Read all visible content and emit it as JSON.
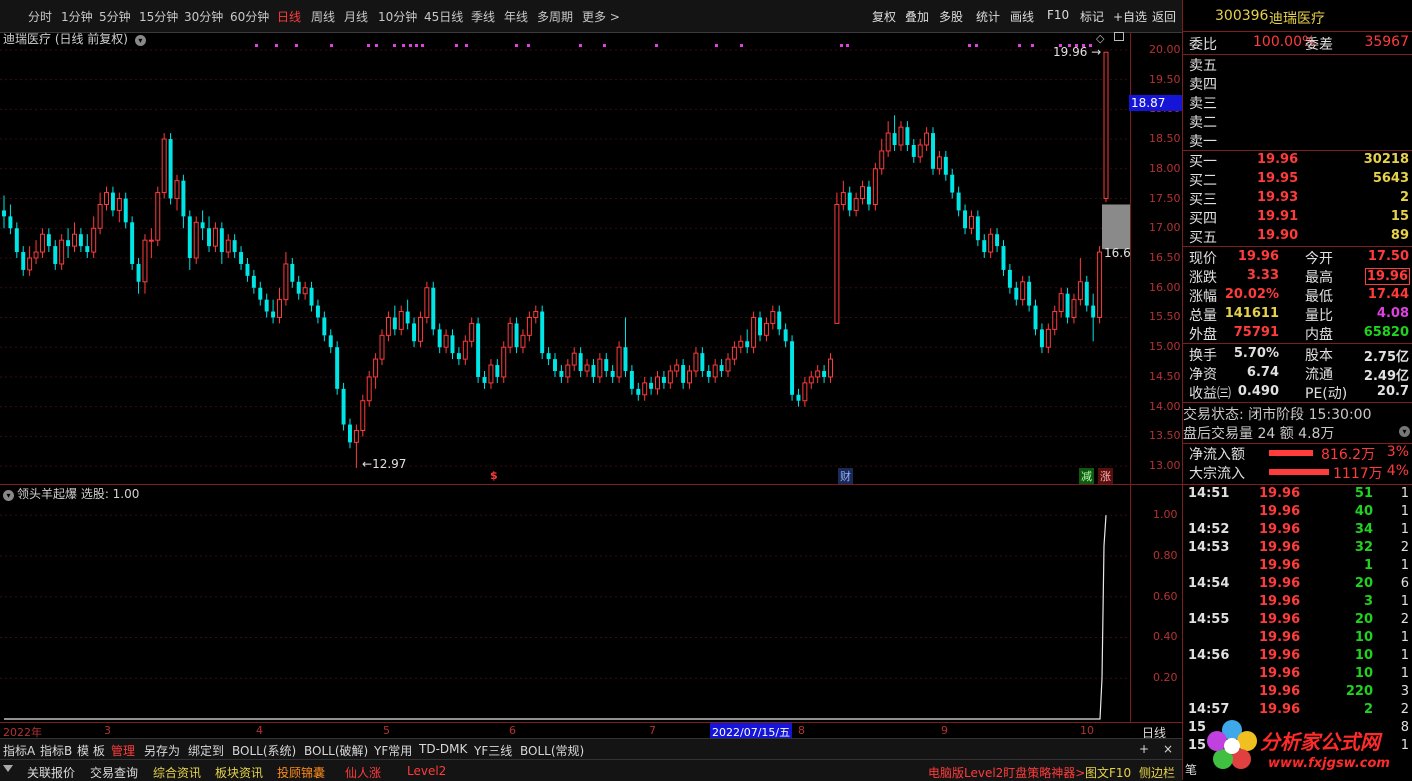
{
  "toolbar": {
    "timeframes": [
      "分时",
      "1分钟",
      "5分钟",
      "15分钟",
      "30分钟",
      "60分钟",
      "日线",
      "周线",
      "月线",
      "10分钟",
      "45日线",
      "季线",
      "年线",
      "多周期",
      "更多 >"
    ],
    "active": "日线",
    "right_buttons": [
      "复权",
      "叠加",
      "多股",
      "统计",
      "画线",
      "F10",
      "标记",
      "+自选",
      "返回"
    ]
  },
  "chart": {
    "title": "迪瑞医疗 (日线 前复权)",
    "price_axis": [
      "20.00",
      "19.50",
      "19.00",
      "18.50",
      "18.00",
      "17.50",
      "17.00",
      "16.50",
      "16.00",
      "15.50",
      "15.00",
      "14.50",
      "14.00",
      "13.50",
      "13.00"
    ],
    "current_price_tag": "18.87",
    "high_annotation": "19.96",
    "low_annotation": "12.97",
    "right_annotation": "16.6",
    "markers": {
      "dollar": "$",
      "fin": "财",
      "jian": "减",
      "zhang": "涨"
    }
  },
  "chart_data": {
    "type": "candlestick",
    "title": "迪瑞医疗 (日线 前复权)",
    "ylim": [
      12.7,
      20.3
    ],
    "y_ticks": [
      13.0,
      13.5,
      14.0,
      14.5,
      15.0,
      15.5,
      16.0,
      16.5,
      17.0,
      17.5,
      18.0,
      18.5,
      19.0,
      19.5,
      20.0
    ],
    "candles": [
      [
        17.3,
        17.2,
        17.55,
        17.0
      ],
      [
        17.2,
        17.0,
        17.4,
        16.9
      ],
      [
        17.0,
        16.6,
        17.1,
        16.5
      ],
      [
        16.6,
        16.3,
        16.7,
        16.2
      ],
      [
        16.3,
        16.5,
        16.7,
        16.2
      ],
      [
        16.5,
        16.6,
        16.8,
        16.4
      ],
      [
        16.6,
        16.9,
        17.0,
        16.5
      ],
      [
        16.9,
        16.7,
        17.0,
        16.6
      ],
      [
        16.7,
        16.4,
        16.8,
        16.3
      ],
      [
        16.4,
        16.8,
        16.9,
        16.3
      ],
      [
        16.8,
        16.7,
        17.0,
        16.5
      ],
      [
        16.7,
        16.9,
        17.1,
        16.6
      ],
      [
        16.9,
        16.7,
        17.0,
        16.6
      ],
      [
        16.7,
        16.6,
        16.9,
        16.5
      ],
      [
        16.6,
        17.0,
        17.2,
        16.5
      ],
      [
        17.0,
        17.4,
        17.6,
        16.9
      ],
      [
        17.4,
        17.6,
        17.7,
        17.3
      ],
      [
        17.6,
        17.3,
        17.7,
        17.2
      ],
      [
        17.3,
        17.5,
        17.6,
        17.1
      ],
      [
        17.5,
        17.1,
        17.6,
        17.0
      ],
      [
        17.1,
        16.4,
        17.2,
        16.3
      ],
      [
        16.4,
        16.1,
        16.5,
        15.9
      ],
      [
        16.1,
        16.8,
        16.9,
        15.9
      ],
      [
        16.8,
        16.8,
        17.0,
        16.5
      ],
      [
        16.8,
        17.6,
        17.7,
        16.7
      ],
      [
        17.6,
        18.5,
        18.6,
        17.5
      ],
      [
        18.5,
        17.5,
        18.6,
        17.4
      ],
      [
        17.5,
        17.8,
        17.9,
        17.3
      ],
      [
        17.8,
        17.2,
        17.9,
        17.0
      ],
      [
        17.2,
        16.5,
        17.3,
        16.3
      ],
      [
        16.5,
        17.1,
        17.2,
        16.4
      ],
      [
        17.1,
        17.0,
        17.3,
        16.8
      ],
      [
        17.0,
        16.7,
        17.2,
        16.6
      ],
      [
        16.7,
        17.0,
        17.1,
        16.6
      ],
      [
        17.0,
        16.6,
        17.1,
        16.4
      ],
      [
        16.6,
        16.8,
        16.9,
        16.5
      ],
      [
        16.8,
        16.6,
        16.9,
        16.5
      ],
      [
        16.6,
        16.4,
        16.7,
        16.3
      ],
      [
        16.4,
        16.2,
        16.5,
        16.1
      ],
      [
        16.2,
        16.0,
        16.3,
        15.9
      ],
      [
        16.0,
        15.8,
        16.1,
        15.7
      ],
      [
        15.8,
        15.6,
        15.9,
        15.5
      ],
      [
        15.6,
        15.5,
        15.8,
        15.4
      ],
      [
        15.5,
        15.8,
        16.0,
        15.4
      ],
      [
        15.8,
        16.4,
        16.6,
        15.7
      ],
      [
        16.4,
        16.1,
        16.5,
        16.0
      ],
      [
        16.1,
        15.9,
        16.2,
        15.8
      ],
      [
        15.9,
        16.0,
        16.1,
        15.8
      ],
      [
        16.0,
        15.7,
        16.1,
        15.6
      ],
      [
        15.7,
        15.5,
        15.8,
        15.4
      ],
      [
        15.5,
        15.2,
        15.6,
        15.1
      ],
      [
        15.2,
        15.0,
        15.3,
        14.9
      ],
      [
        15.0,
        14.3,
        15.1,
        14.2
      ],
      [
        14.3,
        13.7,
        14.4,
        13.6
      ],
      [
        13.7,
        13.4,
        13.8,
        13.3
      ],
      [
        13.4,
        13.6,
        13.7,
        12.97
      ],
      [
        13.6,
        14.1,
        14.2,
        13.5
      ],
      [
        14.1,
        14.5,
        14.6,
        14.0
      ],
      [
        14.5,
        14.8,
        14.9,
        14.3
      ],
      [
        14.8,
        15.2,
        15.3,
        14.7
      ],
      [
        15.2,
        15.5,
        15.6,
        15.1
      ],
      [
        15.5,
        15.3,
        15.7,
        15.2
      ],
      [
        15.3,
        15.6,
        15.7,
        15.2
      ],
      [
        15.6,
        15.4,
        15.8,
        15.3
      ],
      [
        15.4,
        15.1,
        15.5,
        15.0
      ],
      [
        15.1,
        15.5,
        15.6,
        15.0
      ],
      [
        15.5,
        16.0,
        16.1,
        15.4
      ],
      [
        16.0,
        15.3,
        16.1,
        15.2
      ],
      [
        15.3,
        15.0,
        15.4,
        14.9
      ],
      [
        15.0,
        15.2,
        15.3,
        14.9
      ],
      [
        15.2,
        14.9,
        15.3,
        14.8
      ],
      [
        14.9,
        14.8,
        15.0,
        14.7
      ],
      [
        14.8,
        15.1,
        15.2,
        14.7
      ],
      [
        15.1,
        15.4,
        15.5,
        15.0
      ],
      [
        15.4,
        14.5,
        15.5,
        14.4
      ],
      [
        14.5,
        14.4,
        14.6,
        14.3
      ],
      [
        14.4,
        14.7,
        14.8,
        14.3
      ],
      [
        14.7,
        14.5,
        14.8,
        14.4
      ],
      [
        14.5,
        15.0,
        15.1,
        14.4
      ],
      [
        15.0,
        15.4,
        15.5,
        14.9
      ],
      [
        15.4,
        15.0,
        15.5,
        14.9
      ],
      [
        15.0,
        15.2,
        15.3,
        14.9
      ],
      [
        15.2,
        15.5,
        15.6,
        15.1
      ],
      [
        15.5,
        15.6,
        15.7,
        15.4
      ],
      [
        15.6,
        14.9,
        15.7,
        14.8
      ],
      [
        14.9,
        14.8,
        15.0,
        14.7
      ],
      [
        14.8,
        14.6,
        14.9,
        14.5
      ],
      [
        14.6,
        14.5,
        14.7,
        14.4
      ],
      [
        14.5,
        14.7,
        14.8,
        14.4
      ],
      [
        14.7,
        14.9,
        15.0,
        14.6
      ],
      [
        14.9,
        14.6,
        15.0,
        14.5
      ],
      [
        14.6,
        14.7,
        14.8,
        14.5
      ],
      [
        14.7,
        14.5,
        14.8,
        14.4
      ],
      [
        14.5,
        14.8,
        14.9,
        14.4
      ],
      [
        14.8,
        14.6,
        14.9,
        14.5
      ],
      [
        14.6,
        14.5,
        14.7,
        14.4
      ],
      [
        14.5,
        15.0,
        15.1,
        14.4
      ],
      [
        15.0,
        14.6,
        15.5,
        14.5
      ],
      [
        14.6,
        14.3,
        14.7,
        14.2
      ],
      [
        14.3,
        14.2,
        14.4,
        14.1
      ],
      [
        14.2,
        14.4,
        14.5,
        14.1
      ],
      [
        14.4,
        14.3,
        14.5,
        14.2
      ],
      [
        14.3,
        14.5,
        14.6,
        14.2
      ],
      [
        14.5,
        14.4,
        14.6,
        14.3
      ],
      [
        14.4,
        14.6,
        14.7,
        14.3
      ],
      [
        14.6,
        14.7,
        14.8,
        14.5
      ],
      [
        14.7,
        14.4,
        14.8,
        14.3
      ],
      [
        14.4,
        14.6,
        14.7,
        14.3
      ],
      [
        14.6,
        14.9,
        15.0,
        14.5
      ],
      [
        14.9,
        14.6,
        15.0,
        14.5
      ],
      [
        14.6,
        14.5,
        14.7,
        14.4
      ],
      [
        14.5,
        14.7,
        14.8,
        14.4
      ],
      [
        14.7,
        14.6,
        14.8,
        14.5
      ],
      [
        14.6,
        14.8,
        14.9,
        14.5
      ],
      [
        14.8,
        15.0,
        15.1,
        14.7
      ],
      [
        15.0,
        15.1,
        15.2,
        14.9
      ],
      [
        15.1,
        15.0,
        15.3,
        14.9
      ],
      [
        15.0,
        15.5,
        15.6,
        14.9
      ],
      [
        15.5,
        15.2,
        15.6,
        15.1
      ],
      [
        15.2,
        15.4,
        15.5,
        15.1
      ],
      [
        15.4,
        15.6,
        15.7,
        15.3
      ],
      [
        15.6,
        15.3,
        15.7,
        15.2
      ],
      [
        15.3,
        15.1,
        15.4,
        15.0
      ],
      [
        15.1,
        14.2,
        15.2,
        14.1
      ],
      [
        14.2,
        14.1,
        14.3,
        14.0
      ],
      [
        14.1,
        14.4,
        14.5,
        14.0
      ],
      [
        14.4,
        14.5,
        14.6,
        14.3
      ],
      [
        14.5,
        14.6,
        14.7,
        14.4
      ],
      [
        14.6,
        14.5,
        14.7,
        14.4
      ],
      [
        14.5,
        14.8,
        14.9,
        14.4
      ],
      [
        15.4,
        17.4,
        17.6,
        15.4
      ],
      [
        17.4,
        17.6,
        17.8,
        17.3
      ],
      [
        17.6,
        17.3,
        17.7,
        17.2
      ],
      [
        17.3,
        17.5,
        17.6,
        17.2
      ],
      [
        17.5,
        17.7,
        17.8,
        17.4
      ],
      [
        17.7,
        17.4,
        17.8,
        17.3
      ],
      [
        17.4,
        18.0,
        18.1,
        17.3
      ],
      [
        18.0,
        18.3,
        18.5,
        17.9
      ],
      [
        18.3,
        18.6,
        18.8,
        18.2
      ],
      [
        18.6,
        18.4,
        18.9,
        18.3
      ],
      [
        18.4,
        18.7,
        18.8,
        18.3
      ],
      [
        18.7,
        18.4,
        18.8,
        18.3
      ],
      [
        18.4,
        18.2,
        18.5,
        18.1
      ],
      [
        18.2,
        18.4,
        18.5,
        18.1
      ],
      [
        18.4,
        18.6,
        18.7,
        18.3
      ],
      [
        18.6,
        18.0,
        18.7,
        17.9
      ],
      [
        18.0,
        18.2,
        18.3,
        17.9
      ],
      [
        18.2,
        17.9,
        18.3,
        17.8
      ],
      [
        17.9,
        17.6,
        18.0,
        17.5
      ],
      [
        17.6,
        17.3,
        17.7,
        17.2
      ],
      [
        17.3,
        17.0,
        17.4,
        16.9
      ],
      [
        17.0,
        17.2,
        17.3,
        16.9
      ],
      [
        17.2,
        16.8,
        17.3,
        16.7
      ],
      [
        16.8,
        16.6,
        16.9,
        16.5
      ],
      [
        16.6,
        16.9,
        17.0,
        16.5
      ],
      [
        16.9,
        16.7,
        17.0,
        16.6
      ],
      [
        16.7,
        16.3,
        16.8,
        16.2
      ],
      [
        16.3,
        16.0,
        16.4,
        15.9
      ],
      [
        16.0,
        15.8,
        16.1,
        15.7
      ],
      [
        15.8,
        16.1,
        16.2,
        15.7
      ],
      [
        16.1,
        15.7,
        16.2,
        15.6
      ],
      [
        15.7,
        15.3,
        15.8,
        15.2
      ],
      [
        15.3,
        15.0,
        15.4,
        14.9
      ],
      [
        15.0,
        15.3,
        15.4,
        14.9
      ],
      [
        15.3,
        15.6,
        15.7,
        15.2
      ],
      [
        15.6,
        15.9,
        16.0,
        15.5
      ],
      [
        15.9,
        15.5,
        16.0,
        15.4
      ],
      [
        15.5,
        15.8,
        15.9,
        15.4
      ],
      [
        15.8,
        16.1,
        16.5,
        15.7
      ],
      [
        16.1,
        15.7,
        16.2,
        15.6
      ],
      [
        15.7,
        15.5,
        15.9,
        15.1
      ],
      [
        15.5,
        16.6,
        16.7,
        15.4
      ],
      [
        17.5,
        19.96,
        19.96,
        17.44
      ]
    ]
  },
  "indicator": {
    "title": "领头羊起爆 选股: 1.00",
    "axis": [
      "1.00",
      "0.80",
      "0.60",
      "0.40",
      "0.20"
    ],
    "ylim": [
      0,
      1.05
    ],
    "signal_value": 1.0
  },
  "datebar": {
    "labels": [
      "2022年",
      "3",
      "4",
      "5",
      "6",
      "7",
      "8",
      "9",
      "10"
    ],
    "cursor_date": "2022/07/15/五",
    "period_label": "日线"
  },
  "tabs": [
    "指标A",
    "指标B",
    "模 板",
    "管理",
    "另存为",
    "绑定到",
    "BOLL(系统)",
    "BOLL(破解)",
    "YF常用",
    "TD-DMK",
    "YF三线",
    "BOLL(常规)"
  ],
  "tabs_right": [
    "+",
    "×"
  ],
  "bottom_tabs": [
    "关联报价",
    "交易查询",
    "综合资讯",
    "板块资讯",
    "投顾锦囊",
    "仙人涨",
    "Level2",
    "电脑版Level2盯盘策略神器>",
    "图文F10",
    "侧边栏"
  ],
  "quote": {
    "code": "300396",
    "name": "迪瑞医疗",
    "weibi_label": "委比",
    "weibi": "100.00%",
    "weicha_label": "委差",
    "weicha": "35967",
    "asks": [
      "卖五",
      "卖四",
      "卖三",
      "卖二",
      "卖一"
    ],
    "bids": [
      {
        "label": "买一",
        "price": "19.96",
        "vol": "30218"
      },
      {
        "label": "买二",
        "price": "19.95",
        "vol": "5643"
      },
      {
        "label": "买三",
        "price": "19.93",
        "vol": "2"
      },
      {
        "label": "买四",
        "price": "19.91",
        "vol": "15"
      },
      {
        "label": "买五",
        "price": "19.90",
        "vol": "89"
      }
    ],
    "stats": [
      {
        "l1": "现价",
        "v1": "19.96",
        "l2": "今开",
        "v2": "17.50"
      },
      {
        "l1": "涨跌",
        "v1": "3.33",
        "l2": "最高",
        "v2": "19.96"
      },
      {
        "l1": "涨幅",
        "v1": "20.02%",
        "l2": "最低",
        "v2": "17.44"
      },
      {
        "l1": "总量",
        "v1": "141611",
        "l2": "量比",
        "v2": "4.08"
      },
      {
        "l1": "外盘",
        "v1": "75791",
        "l2": "内盘",
        "v2": "65820"
      }
    ],
    "stats2": [
      {
        "l1": "换手",
        "v1": "5.70%",
        "l2": "股本",
        "v2": "2.75亿"
      },
      {
        "l1": "净资",
        "v1": "6.74",
        "l2": "流通",
        "v2": "2.49亿"
      },
      {
        "l1": "收益㈢",
        "v1": "0.490",
        "l2": "PE(动)",
        "v2": "20.7"
      }
    ],
    "trade_status": "交易状态: 闭市阶段 15:30:00",
    "after_hours": "盘后交易量 24 额 4.8万",
    "net_inflow_label": "净流入额",
    "net_inflow": "816.2万",
    "net_inflow_pct": "3%",
    "block_inflow_label": "大宗流入",
    "block_inflow": "1117万",
    "block_inflow_pct": "4%",
    "ticks": [
      {
        "t": "14:51",
        "p": "19.96",
        "v": "51",
        "n": "1"
      },
      {
        "t": "",
        "p": "19.96",
        "v": "40",
        "n": "1"
      },
      {
        "t": "14:52",
        "p": "19.96",
        "v": "34",
        "n": "1"
      },
      {
        "t": "14:53",
        "p": "19.96",
        "v": "32",
        "n": "2"
      },
      {
        "t": "",
        "p": "19.96",
        "v": "1",
        "n": "1"
      },
      {
        "t": "14:54",
        "p": "19.96",
        "v": "20",
        "n": "6"
      },
      {
        "t": "",
        "p": "19.96",
        "v": "3",
        "n": "1"
      },
      {
        "t": "14:55",
        "p": "19.96",
        "v": "20",
        "n": "2"
      },
      {
        "t": "",
        "p": "19.96",
        "v": "10",
        "n": "1"
      },
      {
        "t": "14:56",
        "p": "19.96",
        "v": "10",
        "n": "1"
      },
      {
        "t": "",
        "p": "19.96",
        "v": "10",
        "n": "1"
      },
      {
        "t": "",
        "p": "19.96",
        "v": "220",
        "n": "3"
      },
      {
        "t": "14:57",
        "p": "19.96",
        "v": "2",
        "n": "2"
      },
      {
        "t": "15",
        "p": "",
        "v": "",
        "n": "8"
      },
      {
        "t": "15",
        "p": "",
        "v": "",
        "n": "1"
      }
    ],
    "bottom_tab": "笔"
  },
  "watermark": {
    "text": "分析家公式网",
    "url_text": "www.fxjgsw.com"
  },
  "colors": {
    "up": "#ff3b3b",
    "down": "#00e5e5",
    "axis": "#b53232",
    "grid": "#3a0d0d",
    "magenta": "#e040e0"
  }
}
